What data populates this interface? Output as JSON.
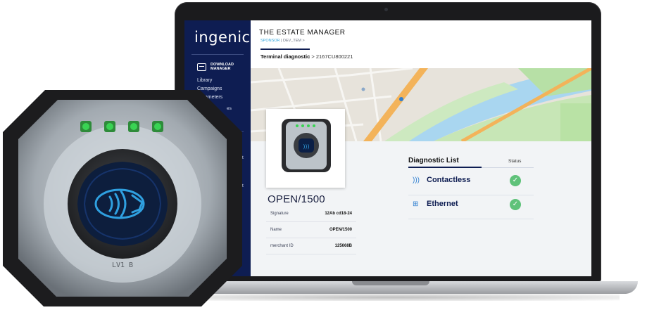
{
  "app": {
    "brand": "ingenico",
    "title": "THE ESTATE MANAGER",
    "breadcrumb_sponsor": "SPONSOR",
    "breadcrumb_rest": " | DEV_TEM >",
    "page_heading": "Terminal diagnostic",
    "page_heading_suffix": " > 2167CU800221"
  },
  "sidebar": {
    "section_label": "DOWNLOAD MANAGER",
    "items": [
      "Library",
      "Campaigns",
      "Parameters"
    ],
    "fragments": [
      "es",
      "t",
      "t"
    ]
  },
  "device": {
    "name": "OPEN/1500",
    "rows": [
      {
        "label": "Signature",
        "value": "12Ab cd18-24"
      },
      {
        "label": "Name",
        "value": "OPEN/1500"
      },
      {
        "label": "merchant ID",
        "value": "125668B"
      }
    ]
  },
  "diagnostics": {
    "title": "Diagnostic List",
    "status_header": "Status",
    "items": [
      {
        "name": "Contactless",
        "icon": "contactless-icon",
        "status": "ok"
      },
      {
        "name": "Ethernet",
        "icon": "ethernet-icon",
        "status": "ok"
      }
    ]
  },
  "hardware_label": {
    "model_code": "LV1 B"
  },
  "colors": {
    "sidebar": "#0e1d52",
    "accent": "#32a6dd",
    "ok": "#5fc27a",
    "led": "#39d353"
  }
}
